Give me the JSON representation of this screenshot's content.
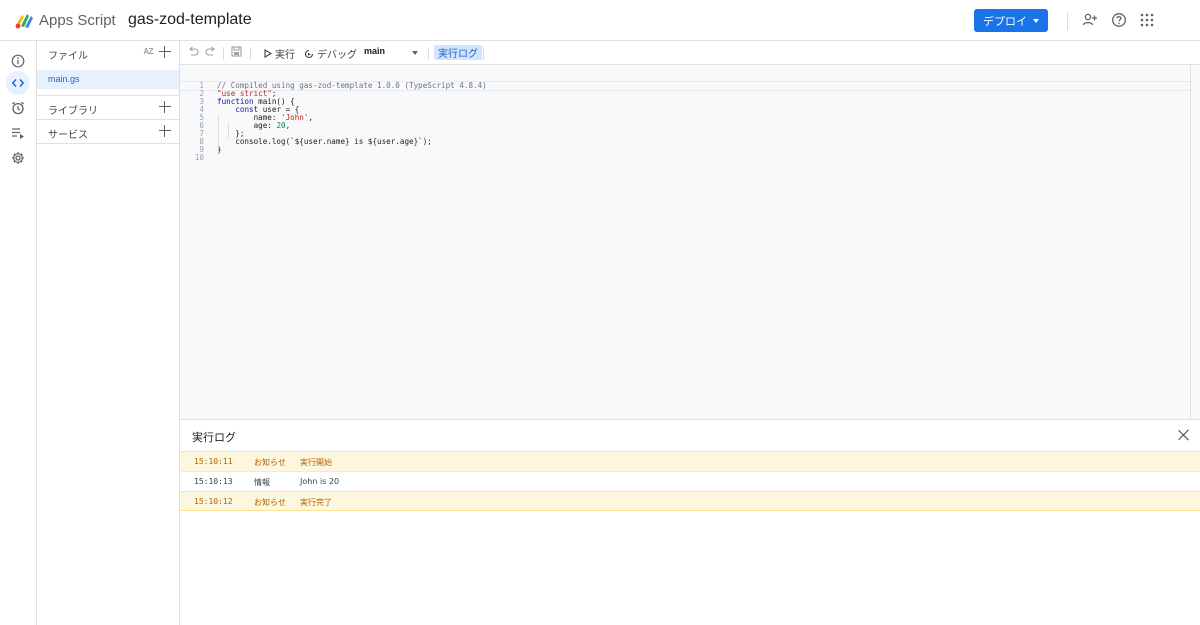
{
  "header": {
    "brand": "Apps Script",
    "project_title": "gas-zod-template",
    "deploy_label": "デプロイ",
    "icons": [
      "add-user-icon",
      "help-icon",
      "apps-grid-icon"
    ]
  },
  "rail": {
    "items": [
      "info-icon",
      "code-icon",
      "clock-icon",
      "executions-icon",
      "gear-icon"
    ],
    "active": "code-icon"
  },
  "files_panel": {
    "files_label": "ファイル",
    "sort_label": "AZ",
    "files": [
      "main.gs"
    ],
    "libraries_label": "ライブラリ",
    "services_label": "サービス"
  },
  "toolbar": {
    "run_label": "実行",
    "debug_label": "デバッグ",
    "function_name": "main",
    "log_label": "実行ログ"
  },
  "editor": {
    "lines": [
      {
        "n": "1",
        "text": "// Compiled using gas-zod-template 1.0.0 (TypeScript 4.8.4)"
      },
      {
        "n": "2",
        "text": "\"use strict\";"
      },
      {
        "n": "3",
        "text": "function main() {"
      },
      {
        "n": "4",
        "text": "    const user = {"
      },
      {
        "n": "5",
        "text": "        name: 'John',"
      },
      {
        "n": "6",
        "text": "        age: 20,"
      },
      {
        "n": "7",
        "text": "    };"
      },
      {
        "n": "8",
        "text": "    console.log(`${user.name} is ${user.age}`);"
      },
      {
        "n": "9",
        "text": "}"
      },
      {
        "n": "10",
        "text": ""
      }
    ]
  },
  "log_panel": {
    "title": "実行ログ",
    "rows": [
      {
        "time": "15:10:11",
        "level": "お知らせ",
        "message": "実行開始",
        "kind": "warn"
      },
      {
        "time": "15:10:13",
        "level": "情報",
        "message": "John is 20",
        "kind": "info"
      },
      {
        "time": "15:10:12",
        "level": "お知らせ",
        "message": "実行完了",
        "kind": "warn"
      }
    ]
  },
  "colors": {
    "accent": "#1a73e8",
    "notice_bg": "#fef7e0",
    "notice_text": "#b06000"
  }
}
